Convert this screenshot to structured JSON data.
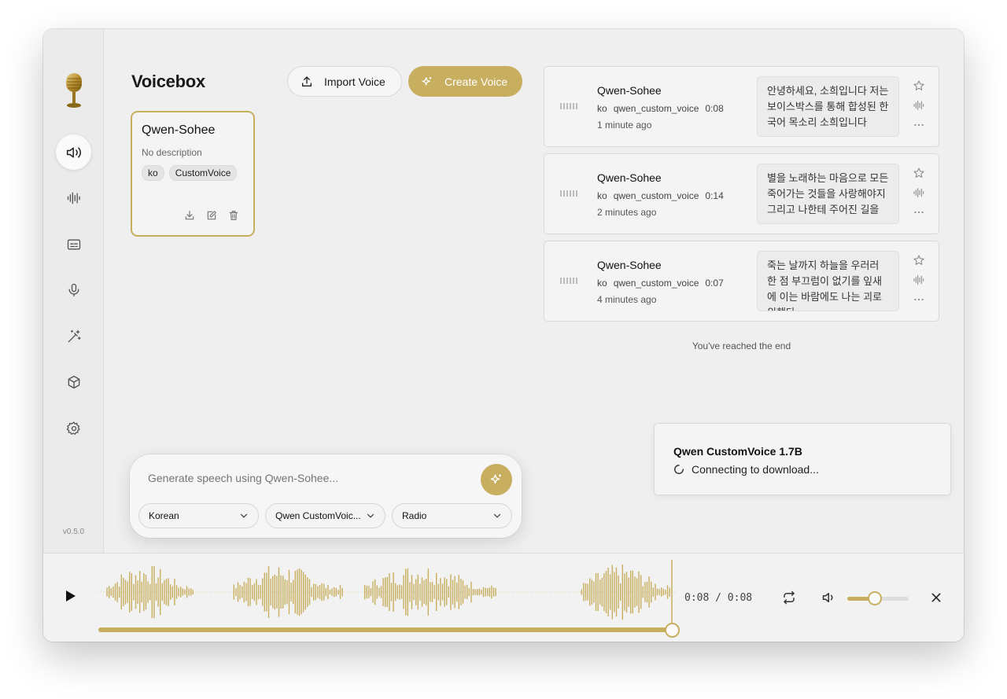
{
  "app": {
    "title": "Voicebox",
    "version": "v0.5.0",
    "accent_color": "#c8ae5f"
  },
  "sidebar": {
    "items": [
      {
        "icon": "speaker-icon",
        "active": true
      },
      {
        "icon": "waveform-icon",
        "active": false
      },
      {
        "icon": "captions-icon",
        "active": false
      },
      {
        "icon": "microphone-icon",
        "active": false
      },
      {
        "icon": "magic-wand-icon",
        "active": false
      },
      {
        "icon": "box-icon",
        "active": false
      },
      {
        "icon": "gear-icon",
        "active": false
      }
    ]
  },
  "toolbar": {
    "import_label": "Import Voice",
    "create_label": "Create Voice"
  },
  "voice_card": {
    "name": "Qwen-Sohee",
    "description": "No description",
    "tags": [
      "ko",
      "CustomVoice"
    ]
  },
  "history": {
    "items": [
      {
        "name": "Qwen-Sohee",
        "lang": "ko",
        "model": "qwen_custom_voice",
        "duration": "0:08",
        "time": "1 minute ago",
        "text": "안녕하세요, 소희입니다 저는 보이스박스를 통해 합성된 한국어 목소리 소희입니다"
      },
      {
        "name": "Qwen-Sohee",
        "lang": "ko",
        "model": "qwen_custom_voice",
        "duration": "0:14",
        "time": "2 minutes ago",
        "text": "별을 노래하는 마음으로 모든 죽어가는 것들을 사랑해야지 그리고 나한테 주어진 길을"
      },
      {
        "name": "Qwen-Sohee",
        "lang": "ko",
        "model": "qwen_custom_voice",
        "duration": "0:07",
        "time": "4 minutes ago",
        "text": "죽는 날까지 하늘을 우러러 한 점 부끄럼이 없기를 잎새에 이는 바람에도 나는 괴로워했다"
      }
    ],
    "end_text": "You've reached the end"
  },
  "toast": {
    "title": "Qwen CustomVoice 1.7B",
    "status": "Connecting to download..."
  },
  "composer": {
    "placeholder": "Generate speech using Qwen-Sohee...",
    "language": "Korean",
    "model": "Qwen CustomVoic...",
    "style": "Radio"
  },
  "player": {
    "current": "0:08",
    "total": "0:08",
    "progress": 1.0,
    "volume": 0.45
  }
}
